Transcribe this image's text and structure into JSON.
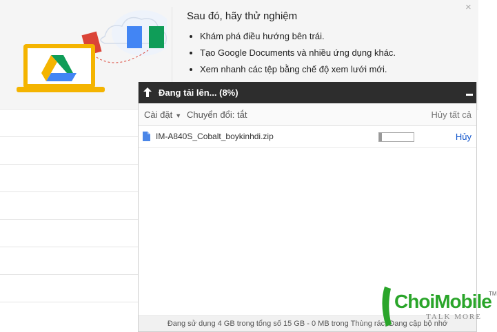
{
  "promo": {
    "title": "Sau đó, hãy thử nghiệm",
    "tips": [
      "Khám phá điều hướng bên trái.",
      "Tạo Google Documents và nhiều ứng dụng khác.",
      "Xem nhanh các tệp bằng chế độ xem lưới mới."
    ],
    "close_label": "×"
  },
  "upload": {
    "title": "Đang tải lên... (8%)",
    "toolbar": {
      "settings_label": "Cài đặt",
      "settings_caret": "▼",
      "convert_label": "Chuyển đổi: tắt",
      "cancel_all_label": "Hủy tất cả"
    },
    "items": [
      {
        "name": "IM-A840S_Cobalt_boykinhdi.zip",
        "progress_fraction": 0.08,
        "cancel_label": "Hủy"
      }
    ],
    "footer": "Đang sử dụng 4 GB trong tổng số 15 GB - 0 MB trong Thùng rác, Đang cập bộ nhớ"
  },
  "watermark": {
    "brand": "ChoiMobile",
    "tagline": "TALK MORE",
    "tm": "TM"
  },
  "colors": {
    "header_bg": "#2d2d2d",
    "link_blue": "#1155cc",
    "drive_green": "#0f9d58",
    "drive_yellow": "#f4b400",
    "drive_blue": "#4285f4",
    "watermark_green": "#2aa52a"
  },
  "icons": {
    "upload_arrow": "upload-arrow-icon",
    "file": "file-icon",
    "close": "close-icon",
    "minimize": "minimize-icon",
    "drive": "drive-logo-icon"
  }
}
